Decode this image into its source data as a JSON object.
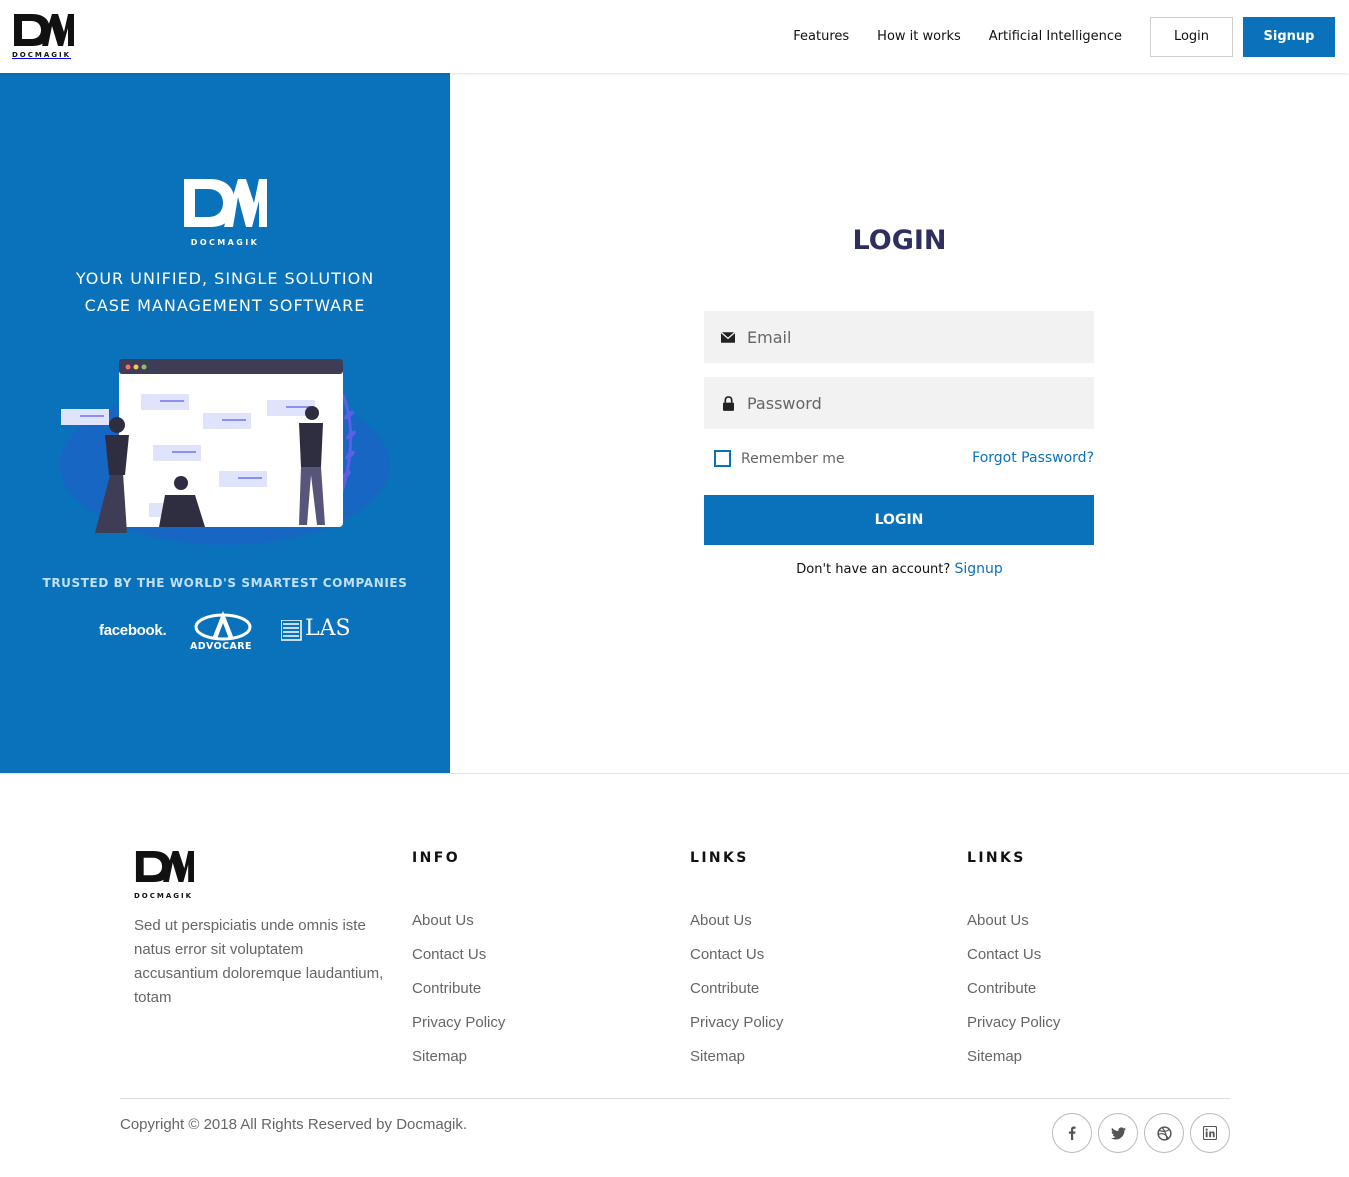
{
  "brand": {
    "name": "DOCMAGIK",
    "logo_letters": "DM"
  },
  "nav": {
    "items": [
      "Features",
      "How it works",
      "Artificial Intelligence"
    ],
    "login_label": "Login",
    "signup_label": "Signup"
  },
  "hero": {
    "tagline_line1": "YOUR UNIFIED, SINGLE SOLUTION",
    "tagline_line2": "CASE MANAGEMENT SOFTWARE",
    "trusted": "TRUSTED BY THE WORLD'S SMARTEST COMPANIES",
    "companies": [
      "facebook.",
      "ADVOCARE",
      "LAS"
    ]
  },
  "login": {
    "title": "LOGIN",
    "email_placeholder": "Email",
    "password_placeholder": "Password",
    "remember_label": "Remember me",
    "forgot_label": "Forgot Password?",
    "submit_label": "LOGIN",
    "no_account_text": "Don't have an account?",
    "signup_link": "Signup"
  },
  "footer": {
    "about_text": "Sed ut perspiciatis unde omnis iste natus error sit voluptatem accusantium doloremque laudantium, totam",
    "columns": [
      {
        "title": "INFO",
        "links": [
          "About Us",
          "Contact Us",
          "Contribute",
          "Privacy Policy",
          "Sitemap"
        ]
      },
      {
        "title": "LINKS",
        "links": [
          "About Us",
          "Contact Us",
          "Contribute",
          "Privacy Policy",
          "Sitemap"
        ]
      },
      {
        "title": "LINKS",
        "links": [
          "About Us",
          "Contact Us",
          "Contribute",
          "Privacy Policy",
          "Sitemap"
        ]
      }
    ],
    "copyright": "Copyright © 2018 All Rights Reserved by Docmagik.",
    "socials": [
      "facebook-icon",
      "twitter-icon",
      "dribbble-icon",
      "linkedin-icon"
    ]
  },
  "colors": {
    "primary": "#0a72ba",
    "title": "#2e2f5e",
    "field_bg": "#f2f2f2",
    "muted": "#666666"
  }
}
